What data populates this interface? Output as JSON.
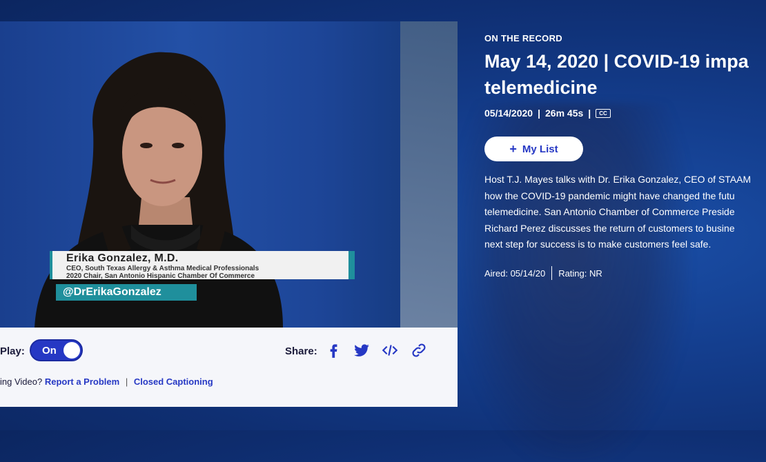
{
  "video": {
    "lower_third": {
      "name": "Erika Gonzalez, M.D.",
      "line1": "CEO, South Texas Allergy & Asthma Medical Professionals",
      "line2": "2020 Chair, San Antonio Hispanic Chamber Of Commerce"
    },
    "handle": "@DrErikaGonzalez"
  },
  "controls": {
    "autoplay_label": "Play:",
    "autoplay_state": "On",
    "share_label": "Share:",
    "share_icons": [
      "facebook-icon",
      "twitter-icon",
      "embed-code-icon",
      "copy-link-icon"
    ],
    "help_prefix": "ing Video?",
    "report_link": "Report a Problem",
    "separator": "|",
    "captioning_link": "Closed Captioning"
  },
  "episode": {
    "show": "ON THE RECORD",
    "title_line1": "May 14, 2020 | COVID-19 impa",
    "title_line2": "telemedicine",
    "date": "05/14/2020",
    "duration": "26m 45s",
    "separator": "|",
    "cc_badge": "CC",
    "my_list_label": "My List",
    "description_lines": [
      "Host T.J. Mayes talks with Dr. Erika Gonzalez, CEO of STAAM",
      "how the COVID-19 pandemic might have changed the futu",
      "telemedicine. San Antonio Chamber of Commerce Preside",
      "Richard Perez discusses the return of customers to busine",
      "next step for success is to make customers feel safe."
    ],
    "aired": "Aired: 05/14/20",
    "rating": "Rating: NR"
  },
  "colors": {
    "accent": "#2638c4",
    "background": "#143e8e",
    "teal": "#1f8f9c"
  }
}
